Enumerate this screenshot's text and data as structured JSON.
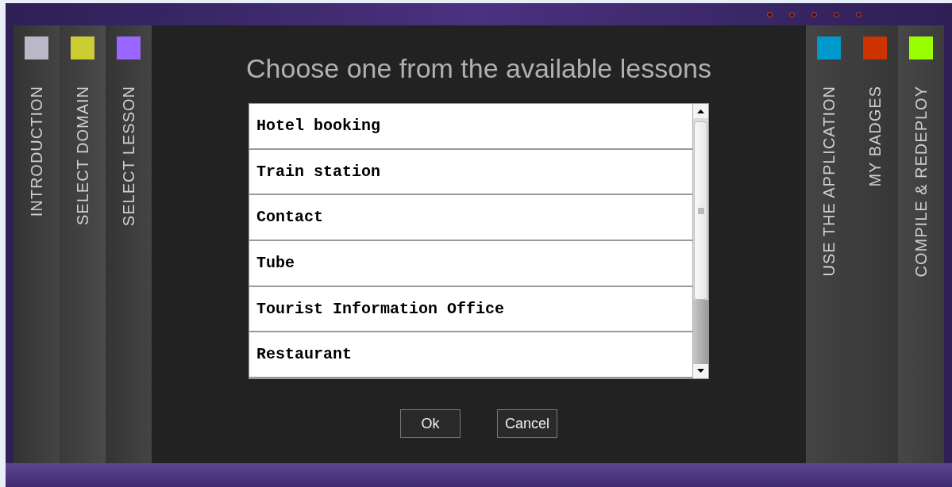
{
  "left_tabs": [
    {
      "label": "INTRODUCTION",
      "color": "#b8b8c8"
    },
    {
      "label": "SELECT DOMAIN",
      "color": "#cccc33"
    },
    {
      "label": "SELECT LESSON",
      "color": "#9966ff"
    }
  ],
  "title": "Choose one from the available lessons",
  "lessons": [
    "Hotel booking",
    "Train station",
    "Contact",
    "Tube",
    "Tourist Information Office",
    "Restaurant"
  ],
  "buttons": [
    "Ok",
    "Cancel"
  ],
  "right_tabs": [
    {
      "label": "USE THE APPLICATION",
      "color": "#0099cc"
    },
    {
      "label": "MY BADGES",
      "color": "#cc3300"
    },
    {
      "label": "COMPILE & REDEPLOY",
      "color": "#99ff00"
    }
  ]
}
